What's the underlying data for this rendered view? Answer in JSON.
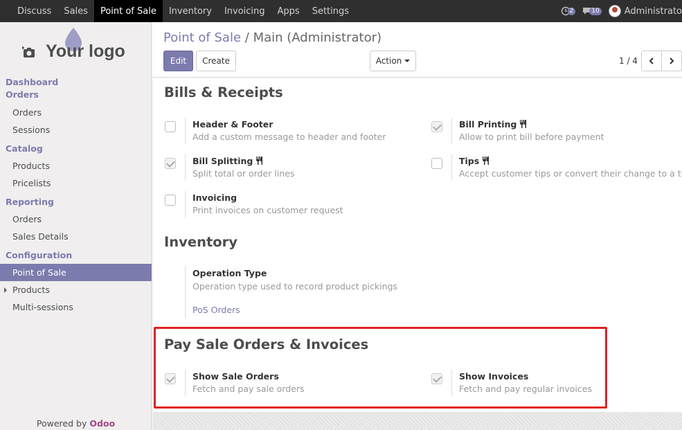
{
  "topnav": {
    "items": [
      "Discuss",
      "Sales",
      "Point of Sale",
      "Inventory",
      "Invoicing",
      "Apps",
      "Settings"
    ],
    "active": "Point of Sale",
    "activity_count": "2",
    "messages_count": "10",
    "user": "Administrato"
  },
  "sidebar": {
    "logo_text": "Your logo",
    "dashboard": "Dashboard",
    "orders_head": "Orders",
    "orders_items": [
      "Orders",
      "Sessions"
    ],
    "catalog_head": "Catalog",
    "catalog_items": [
      "Products",
      "Pricelists"
    ],
    "reporting_head": "Reporting",
    "reporting_items": [
      "Orders",
      "Sales Details"
    ],
    "configuration_head": "Configuration",
    "configuration_items": [
      "Point of Sale",
      "Products",
      "Multi-sessions"
    ],
    "powered_prefix": "Powered by",
    "powered_brand": "Odoo"
  },
  "control": {
    "breadcrumb_link": "Point of Sale",
    "breadcrumb_sep": "/",
    "breadcrumb_current": "Main (Administrator)",
    "edit_label": "Edit",
    "create_label": "Create",
    "action_label": "Action",
    "pager": "1 / 4"
  },
  "bills": {
    "heading": "Bills & Receipts",
    "header_footer": {
      "title": "Header & Footer",
      "desc": "Add a custom message to header and footer",
      "checked": false
    },
    "bill_printing": {
      "title": "Bill Printing",
      "desc": "Allow to print bill before payment",
      "checked": true
    },
    "bill_splitting": {
      "title": "Bill Splitting",
      "desc": "Split total or order lines",
      "checked": true
    },
    "tips": {
      "title": "Tips",
      "desc": "Accept customer tips or convert their change to a tip",
      "checked": false
    },
    "invoicing": {
      "title": "Invoicing",
      "desc": "Print invoices on customer request",
      "checked": false
    }
  },
  "inventory": {
    "heading": "Inventory",
    "operation_type": {
      "title": "Operation Type",
      "desc": "Operation type used to record product pickings",
      "value": "PoS Orders"
    }
  },
  "pay": {
    "heading": "Pay Sale Orders & Invoices",
    "show_sale_orders": {
      "title": "Show Sale Orders",
      "desc": "Fetch and pay sale orders",
      "checked": true
    },
    "show_invoices": {
      "title": "Show Invoices",
      "desc": "Fetch and pay regular invoices",
      "checked": true
    }
  },
  "colors": {
    "accent": "#7c7bad",
    "highlight": "#e02020",
    "topbar": "#2f2f2f"
  }
}
